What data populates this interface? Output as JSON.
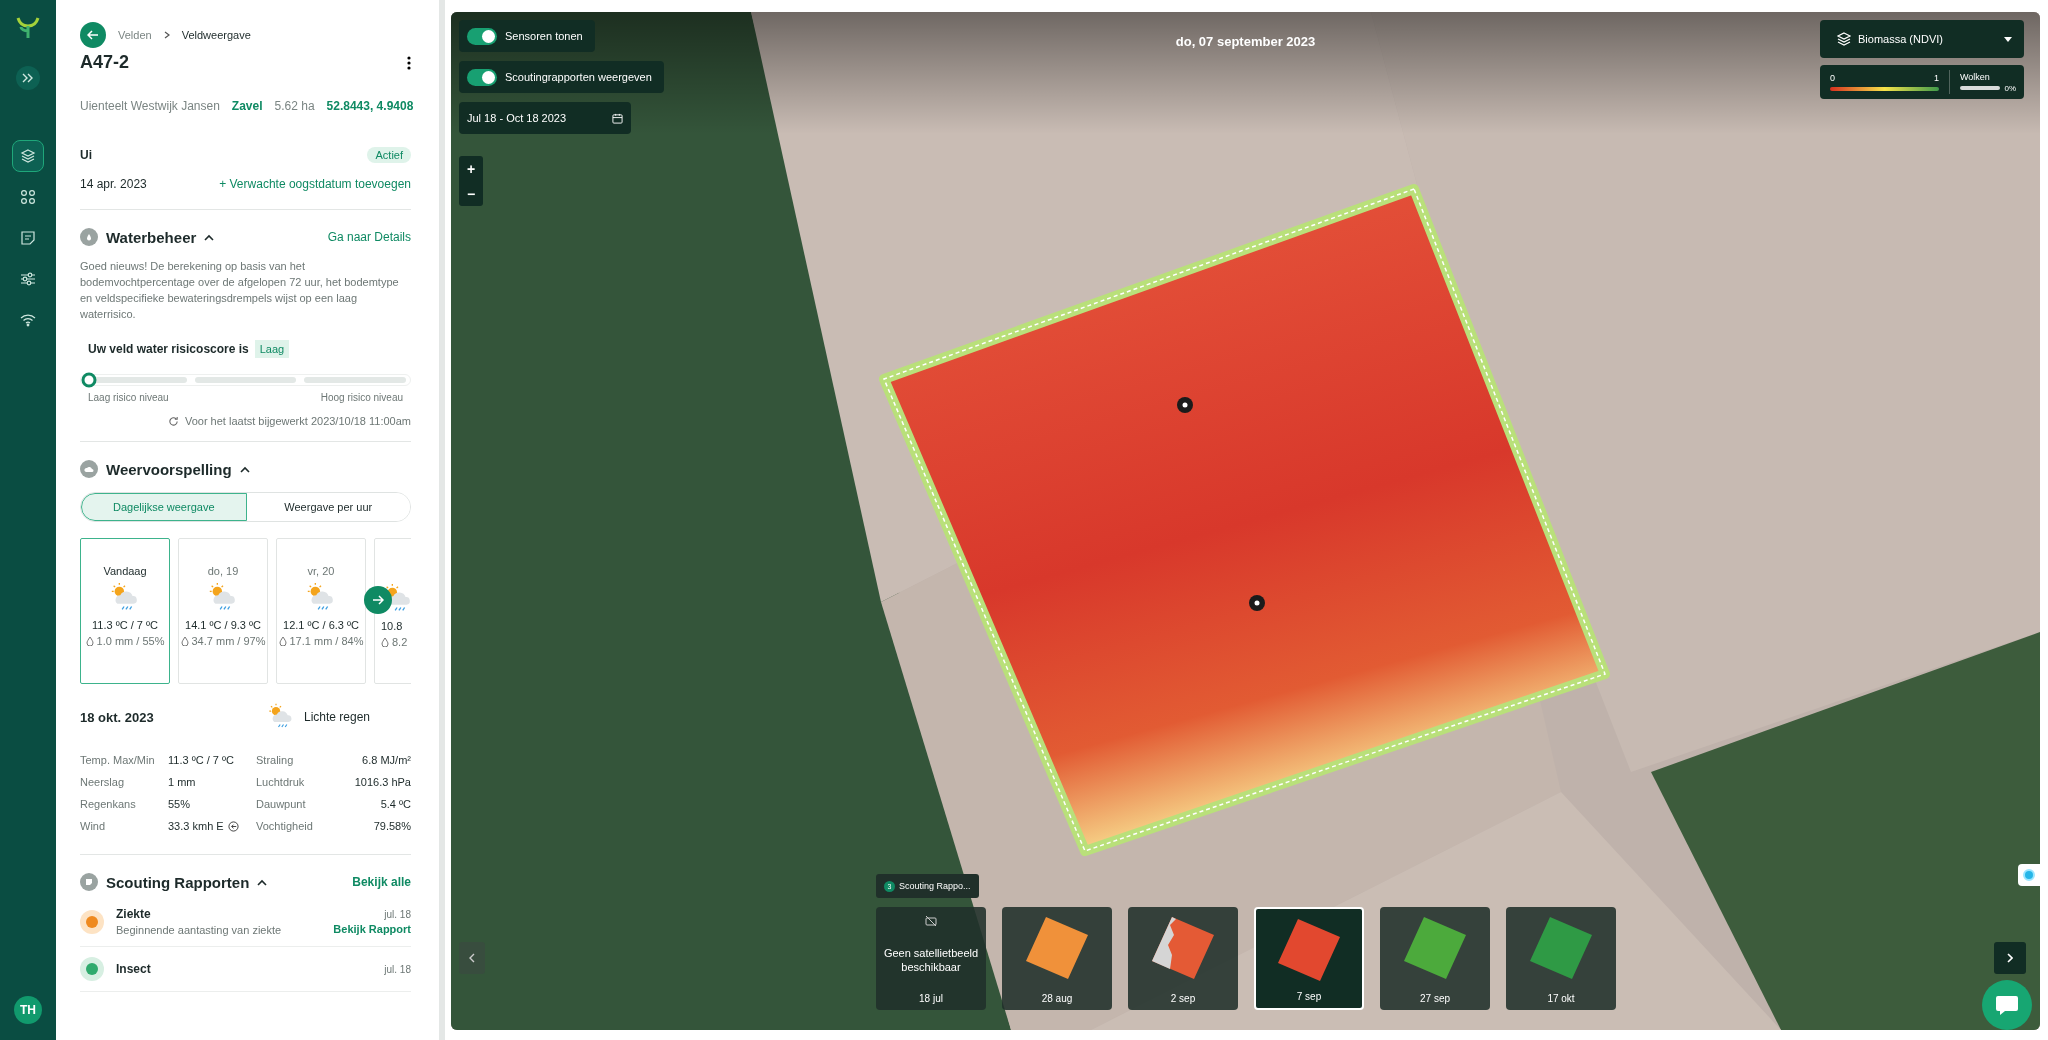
{
  "rail": {
    "items": [
      {
        "selected": true
      },
      {
        "selected": false
      },
      {
        "selected": false
      },
      {
        "selected": false
      },
      {
        "selected": false
      }
    ],
    "avatar": "TH"
  },
  "panel": {
    "breadcrumb": [
      "Velden",
      "Veldweergave"
    ],
    "title": "A47-2",
    "meta": [
      {
        "text": "Uienteelt Westwijk Jansen",
        "link": false
      },
      {
        "text": "Zavel",
        "link": true
      },
      {
        "text": "5.62 ha",
        "link": false
      },
      {
        "text": "52.8443, 4.9408",
        "link": true
      }
    ],
    "crop": "Ui",
    "status": "Actief",
    "sow_date": "14 apr. 2023",
    "harvest_action": "+ Verwachte oogstdatum toevoegen",
    "water": {
      "title": "Waterbeheer",
      "expanded": true,
      "link": "Ga naar Details",
      "text": "Goed nieuws! De berekening op basis van het bodemvochtpercentage over de afgelopen 72 uur, het bodemtype en veldspecifieke bewateringsdrempels wijst op een laag waterrisico.",
      "risk_label": "Uw veld water risicoscore is",
      "risk_value": "Laag",
      "level": 0,
      "low_label": "Laag risico niveau",
      "high_label": "Hoog risico niveau",
      "updated": "Voor het laatst bijgewerkt 2023/10/18 11:00am"
    },
    "weather": {
      "title": "Weervoorspelling",
      "expanded": true,
      "modes": [
        {
          "label": "Dagelijkse weergave",
          "selected": true
        },
        {
          "label": "Weergave per uur",
          "selected": false
        }
      ],
      "days": [
        {
          "day": "Vandaag",
          "temp": "11.3 ºC / 7 ºC",
          "rain": "1.0 mm / 55%",
          "selected": true
        },
        {
          "day": "do, 19",
          "temp": "14.1 ºC / 9.3 ºC",
          "rain": "34.7 mm / 97%",
          "selected": false
        },
        {
          "day": "vr, 20",
          "temp": "12.1 ºC / 6.3 ºC",
          "rain": "17.1 mm / 84%",
          "selected": false
        },
        {
          "temp": "10.8",
          "rain": "8.2",
          "selected": false
        }
      ],
      "date": "18 okt. 2023",
      "condition": "Lichte regen",
      "stats": [
        {
          "label": "Temp. Max/Min",
          "value": "11.3 ºC / 7 ºC"
        },
        {
          "label": "Straling",
          "value": "6.8 MJ/m²"
        },
        {
          "label": "Neerslag",
          "value": "1 mm"
        },
        {
          "label": "Luchtdruk",
          "value": "1016.3 hPa"
        },
        {
          "label": "Regenkans",
          "value": "55%"
        },
        {
          "label": "Dauwpunt",
          "value": "5.4 ºC"
        },
        {
          "label": "Wind",
          "value": "33.3 kmh E",
          "kind": "wind"
        },
        {
          "label": "Vochtigheid",
          "value": "79.58%"
        }
      ]
    },
    "scouting": {
      "title": "Scouting Rapporten",
      "expanded": true,
      "link": "Bekijk alle",
      "reports": [
        {
          "kind": "disease",
          "title": "Ziekte",
          "text": "Beginnende aantasting van ziekte",
          "date": "jul. 18",
          "action": "Bekijk Rapport"
        },
        {
          "kind": "insect",
          "title": "Insect",
          "date": "jul. 18"
        }
      ]
    }
  },
  "map": {
    "toggles": [
      {
        "label": "Sensoren tonen",
        "on": true
      },
      {
        "label": "Scoutingrapporten weergeven",
        "on": true
      }
    ],
    "date_range": "Jul 18 - Oct 18 2023",
    "zoom_in": "+",
    "zoom_out": "−",
    "date": "do, 07 september 2023",
    "layer": "Biomassa (NDVI)",
    "legend": {
      "min": "0",
      "max": "1",
      "clouds_label": "Wolken",
      "clouds_value": "0%"
    },
    "scouting_tag": {
      "count": "3",
      "label": "Scouting Rappo..."
    },
    "thumbnails": [
      {
        "kind": "empty",
        "text": "Geen satellietbeeld beschikbaar",
        "date": "18 jul",
        "selected": false
      },
      {
        "kind": "image",
        "color": "#f0913a",
        "date": "28 aug",
        "selected": false
      },
      {
        "kind": "cloudy",
        "color": "#e45a35",
        "date": "2 sep",
        "selected": false
      },
      {
        "kind": "image",
        "color": "#e2482f",
        "date": "7 sep",
        "selected": true
      },
      {
        "kind": "image",
        "color": "#4caa3c",
        "date": "27 sep",
        "selected": false
      },
      {
        "kind": "image",
        "color": "#2f9a45",
        "date": "17 okt",
        "selected": false
      }
    ]
  }
}
